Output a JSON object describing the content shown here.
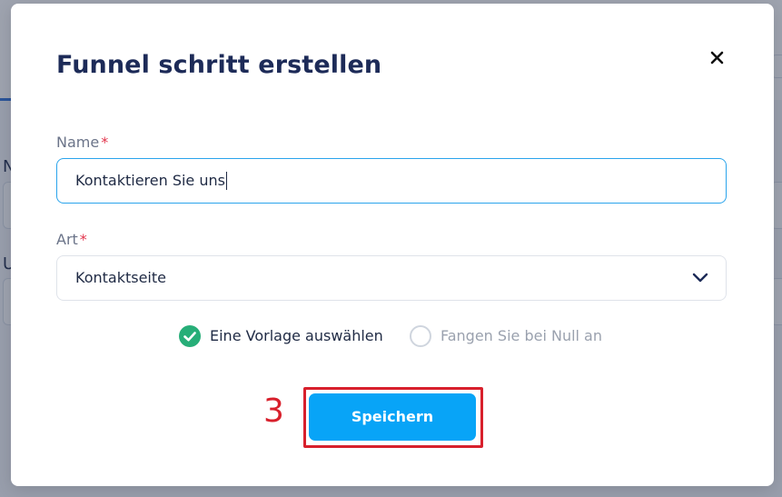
{
  "background": {
    "letter_n": "N",
    "letter_u": "U"
  },
  "modal": {
    "title": "Funnel schritt erstellen",
    "close_icon": "close-icon",
    "name_field": {
      "label": "Name",
      "required_marker": "*",
      "value": "Kontaktieren Sie uns"
    },
    "type_field": {
      "label": "Art",
      "required_marker": "*",
      "selected_value": "Kontaktseite",
      "chevron_icon": "chevron-down-icon"
    },
    "options": [
      {
        "label": "Eine Vorlage auswählen",
        "selected": true
      },
      {
        "label": "Fangen Sie bei Null an",
        "selected": false
      }
    ],
    "save_label": "Speichern"
  },
  "annotation": {
    "step_number": "3",
    "color": "#d8202c"
  },
  "colors": {
    "title": "#1d2b58",
    "accent_button": "#08a4f7",
    "input_focus_border": "#2aa4ec",
    "check_green": "#27ae78",
    "required": "#e2334b"
  }
}
